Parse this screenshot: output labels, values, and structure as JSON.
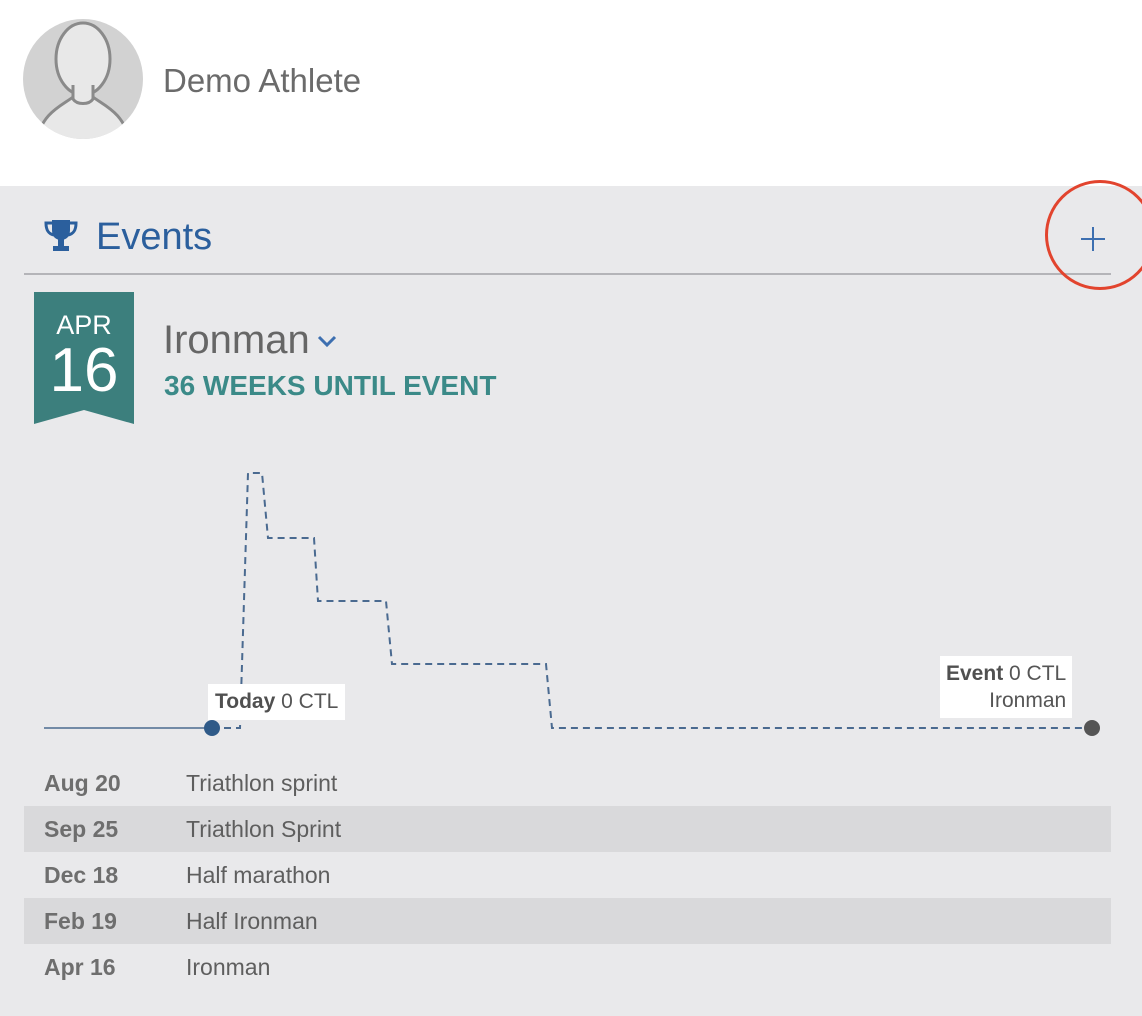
{
  "athlete": {
    "name": "Demo Athlete"
  },
  "events_section": {
    "title": "Events",
    "add_icon": "plus-icon",
    "header_icon": "trophy-icon",
    "accent_color": "#2b5f9d",
    "highlight_color": "#e2442e"
  },
  "featured_event": {
    "month": "APR",
    "day": "16",
    "name": "Ironman",
    "countdown": "36 WEEKS UNTIL EVENT",
    "ribbon_color": "#3c7f7d"
  },
  "chart": {
    "today_label": "Today",
    "today_value": "0 CTL",
    "event_label": "Event",
    "event_value": "0 CTL",
    "event_name": "Ironman"
  },
  "events": [
    {
      "date": "Aug 20",
      "name": "Triathlon sprint"
    },
    {
      "date": "Sep 25",
      "name": "Triathlon Sprint"
    },
    {
      "date": "Dec 18",
      "name": "Half marathon"
    },
    {
      "date": "Feb 19",
      "name": "Half Ironman"
    },
    {
      "date": "Apr 16",
      "name": "Ironman"
    }
  ]
}
